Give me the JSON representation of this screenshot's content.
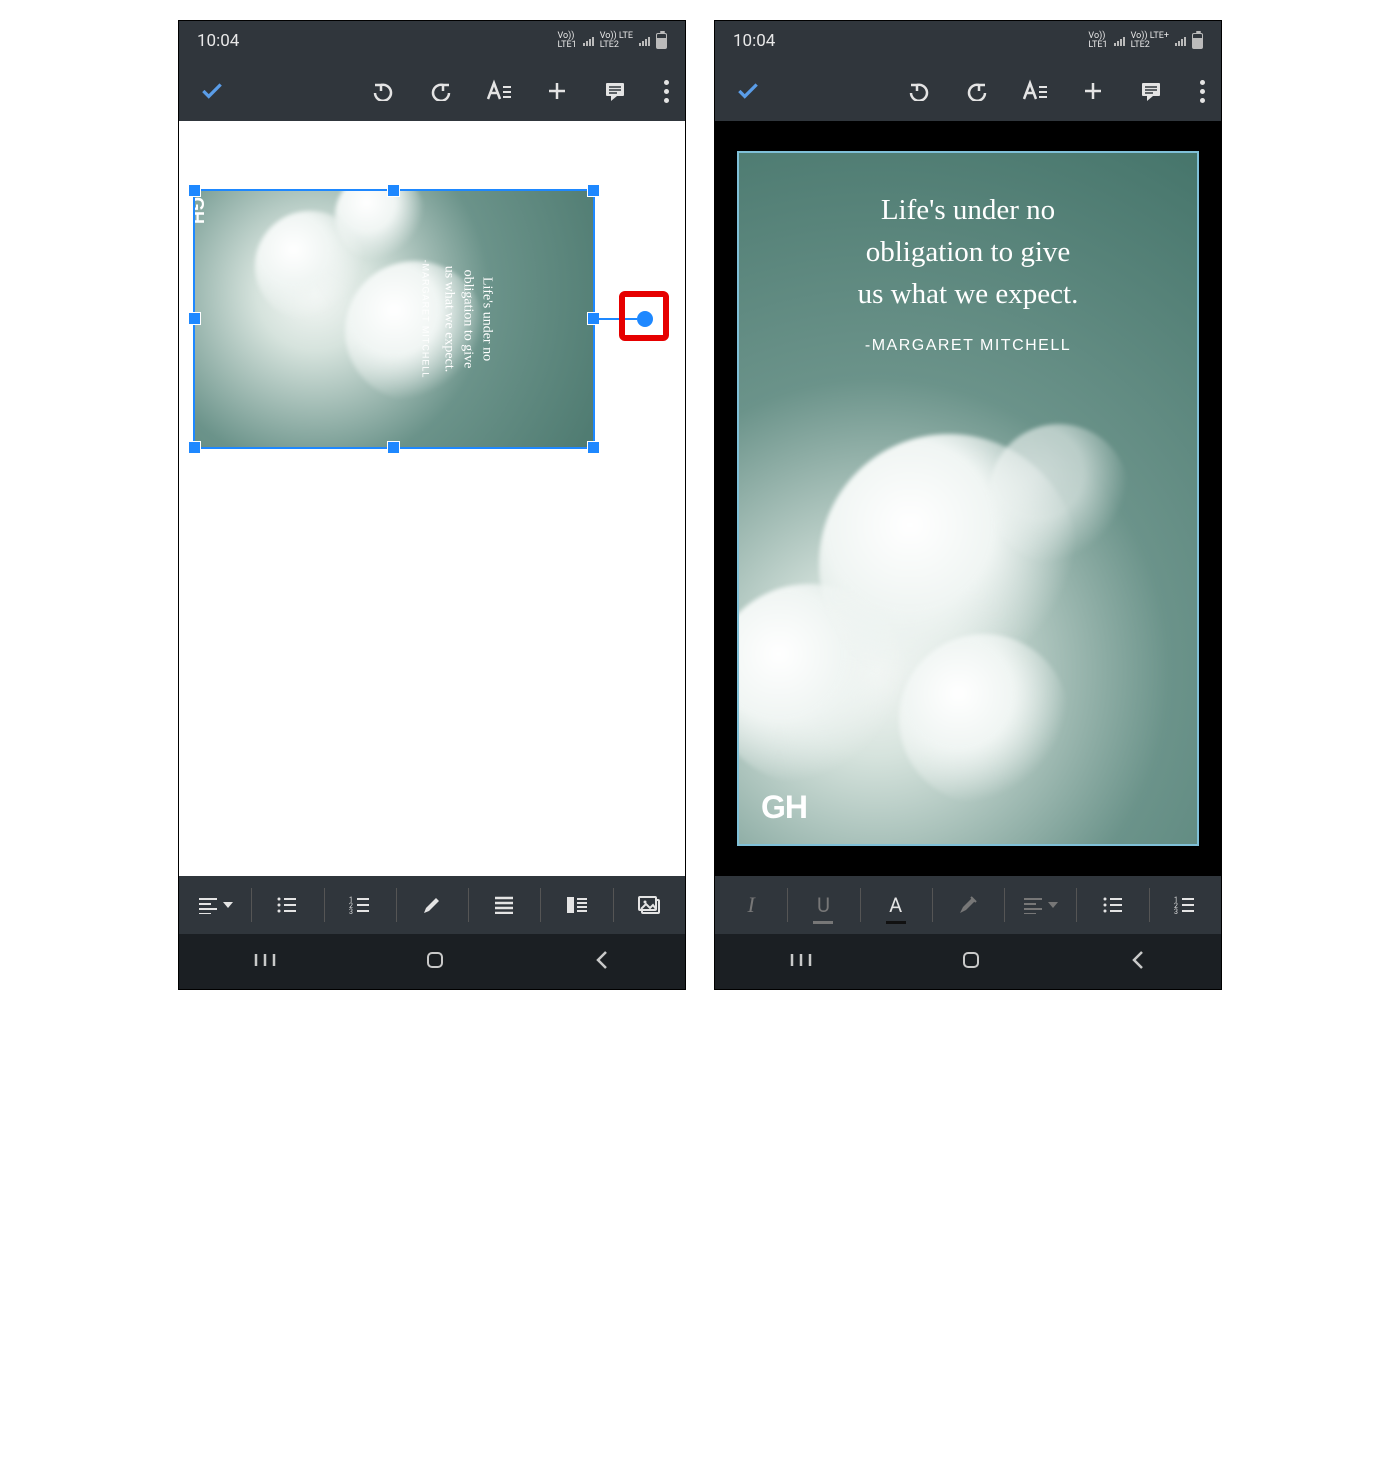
{
  "status": {
    "time": "10:04",
    "sim1_top": "Vo))",
    "sim1_btm": "LTE1",
    "sim2_top_left": "Vo)) LTE",
    "sim2_btm_left": "LTE2",
    "sim2_top_right": "Vo)) LTE+",
    "sim2_btm_right": "LTE2"
  },
  "quote": {
    "line1": "Life's under no",
    "line2": "obligation to give",
    "line3": "us what we expect.",
    "attribution": "-MARGARET MITCHELL",
    "logo": "GH"
  },
  "icons": {
    "check": "check-icon",
    "undo": "undo-icon",
    "redo": "redo-icon",
    "textformat": "text-format-icon",
    "plus": "plus-icon",
    "comment": "comment-icon",
    "more": "more-vertical-icon",
    "align": "align-left-icon",
    "bullets": "bulleted-list-icon",
    "numbers": "numbered-list-icon",
    "pencil": "pencil-icon",
    "justify": "justify-icon",
    "indent": "indent-icon",
    "image": "image-icon",
    "italic": "italic-icon",
    "underline_letter": "U",
    "fontcolor_letter": "A",
    "highlight": "highlighter-icon",
    "nav_recent": "recent-apps-icon",
    "nav_home": "home-icon",
    "nav_back": "back-icon"
  },
  "colors": {
    "selection": "#1e88ff",
    "highlight_box": "#e60000",
    "toolbar_bg": "#30363c",
    "nav_bg": "#1b1f23",
    "image_border_right": "#7fc0d8"
  }
}
